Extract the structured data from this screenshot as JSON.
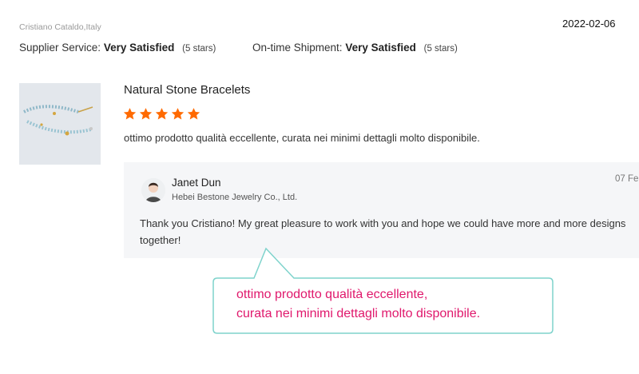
{
  "reviewer": {
    "name_location": "Cristiano Cataldo,Italy"
  },
  "date": "2022-02-06",
  "ratings": [
    {
      "label": "Supplier Service:",
      "value": "Very Satisfied",
      "stars": "(5 stars)"
    },
    {
      "label": "On-time Shipment:",
      "value": "Very Satisfied",
      "stars": "(5 stars)"
    }
  ],
  "product": {
    "name": "Natural Stone Bracelets",
    "image": "bracelet-photo",
    "rating": 5,
    "review": "ottimo prodotto qualità eccellente, curata nei minimi dettagli molto disponibile."
  },
  "reply": {
    "name": "Janet Dun",
    "company": "Hebei Bestone Jewelry Co., Ltd.",
    "date": "07 Fe",
    "text": "Thank you Cristiano! My great pleasure to work with you and hope we could have more and more designs together!"
  },
  "callout": {
    "line1": "ottimo prodotto qualità eccellente,",
    "line2": "curata nei minimi dettagli molto disponibile."
  },
  "colors": {
    "star": "#ff6a00",
    "callout_border": "#7fd3cc",
    "callout_text": "#e0186c"
  }
}
